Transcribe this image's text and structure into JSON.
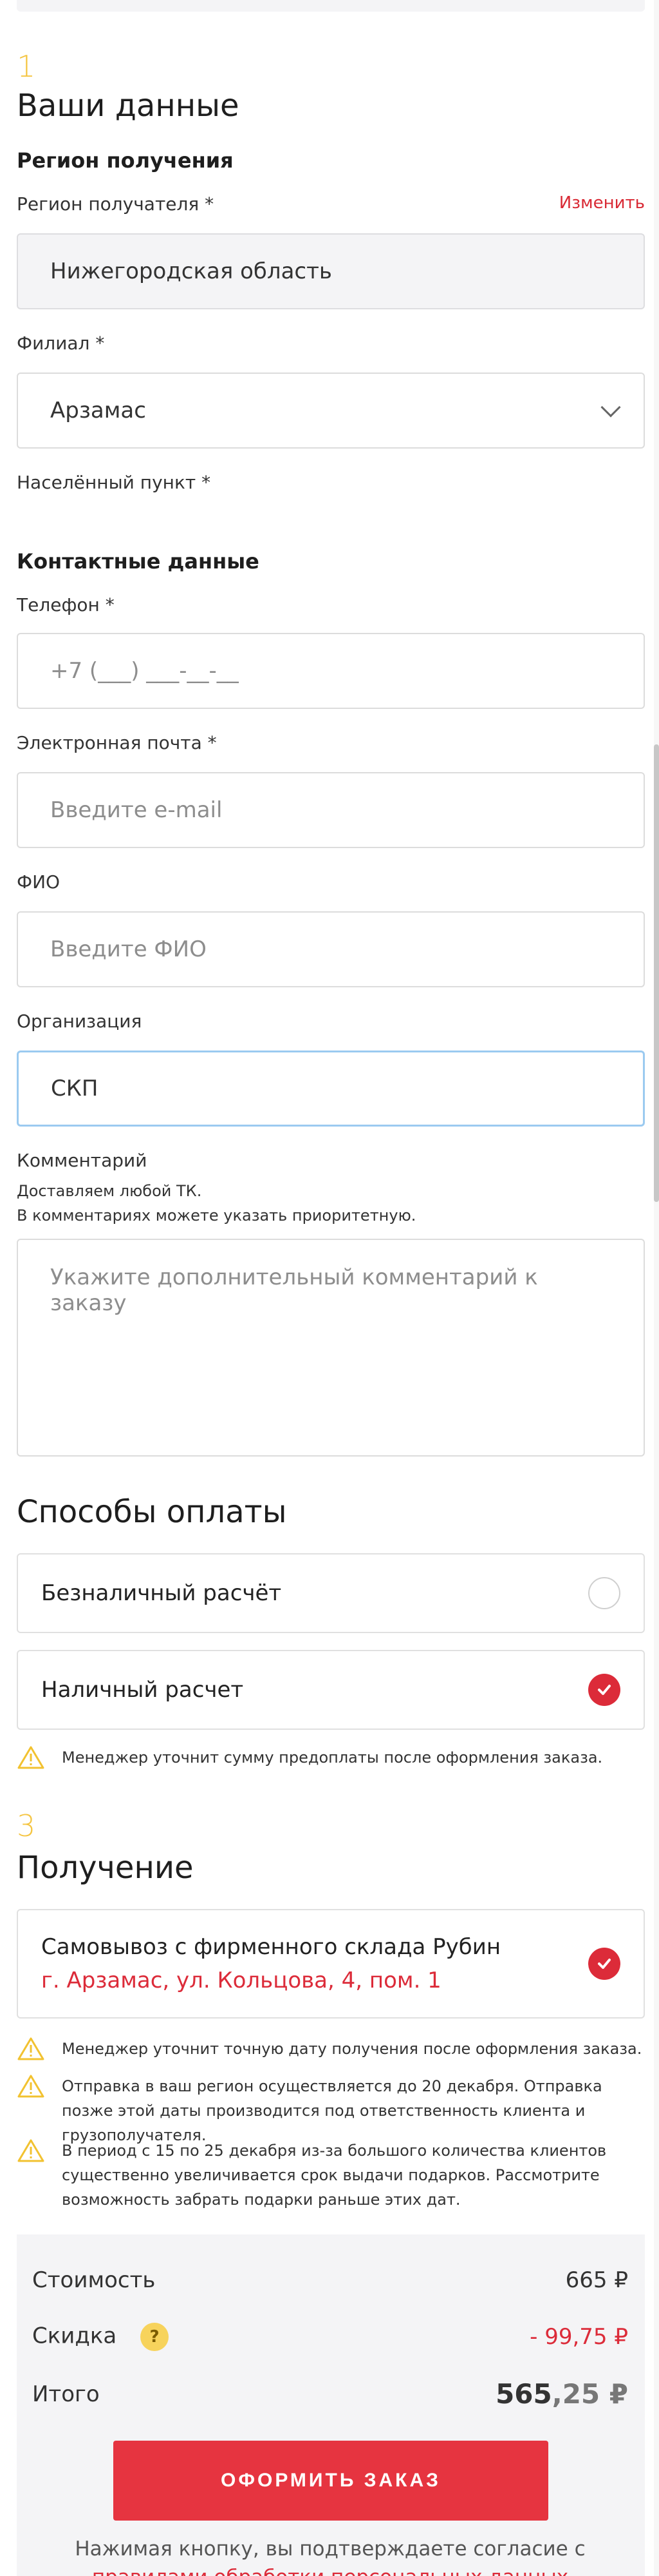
{
  "step1": {
    "number": "1",
    "title": "Ваши данные",
    "region_section": "Регион получения",
    "region_label": "Регион получателя *",
    "region_change": "Изменить",
    "region_value": "Нижегородская область",
    "branch_label": "Филиал *",
    "branch_value": "Арзамас",
    "locality_label": "Населённый пункт *"
  },
  "contacts": {
    "title": "Контактные данные",
    "phone_label": "Телефон *",
    "phone_value": "+7 (___) ___-__-__",
    "email_label": "Электронная почта *",
    "email_placeholder": "Введите e-mail",
    "name_label": "ФИО",
    "name_placeholder": "Введите ФИО",
    "org_label": "Организация",
    "org_value": "СКП",
    "comment_label": "Комментарий",
    "comment_hint1": "Доставляем любой ТК.",
    "comment_hint2": "В комментариях можете указать приоритетную.",
    "comment_placeholder": "Укажите дополнительный комментарий к заказу"
  },
  "payment": {
    "title": "Способы оплаты",
    "options": [
      {
        "label": "Безналичный расчёт",
        "selected": false
      },
      {
        "label": "Наличный расчет",
        "selected": true
      }
    ],
    "note": "Менеджер уточнит сумму предоплаты после оформления заказа."
  },
  "step3": {
    "number": "3",
    "title": "Получение",
    "pickup_title": "Самовывоз с фирменного склада Рубин",
    "pickup_address": "г. Арзамас, ул. Кольцова, 4, пом. 1",
    "notes": [
      "Менеджер уточнит точную дату получения после оформления заказа.",
      "Отправка в ваш регион осуществляется до 20 декабря. Отправка позже этой даты производится под ответственность клиента и грузополучателя.",
      "В период с 15 по 25 декабря из-за большого количества клиентов существенно увеличивается срок выдачи подарков. Рассмотрите возможность забрать подарки раньше этих дат."
    ]
  },
  "summary": {
    "cost_label": "Стоимость",
    "cost_value": "665 ₽",
    "discount_label": "Скидка",
    "discount_help": "?",
    "discount_value": "- 99,75 ₽",
    "total_label": "Итого",
    "total_int": "565",
    "total_frac": ",25 ₽",
    "order_button": "ОФОРМИТЬ ЗАКАЗ",
    "consent_text": "Нажимая кнопку, вы подтверждаете согласие с ",
    "consent_link": "правилами обработки персональных данных"
  },
  "colors": {
    "accent_red": "#dc2b39",
    "step_yellow": "#f5c542",
    "warning_yellow": "#f2c230"
  }
}
